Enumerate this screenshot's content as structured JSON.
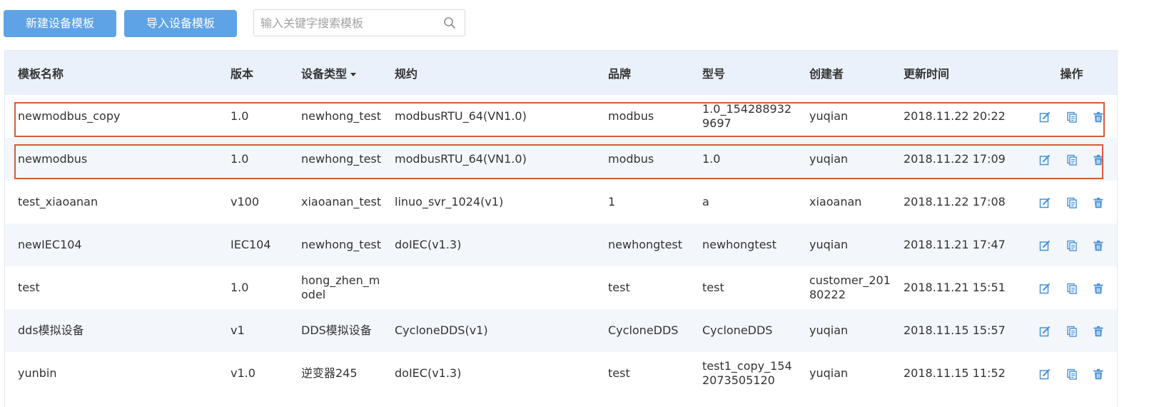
{
  "toolbar": {
    "new_button": "新建设备模板",
    "import_button": "导入设备模板",
    "search_placeholder": "输入关键字搜索模板",
    "search_value": ""
  },
  "colors": {
    "button_blue": "#5ea3e6",
    "header_bg": "#eaf1fa",
    "stripe_bg": "#f3f7fc",
    "icon_blue": "#4a90d9",
    "highlight_red": "#d95a3a"
  },
  "table": {
    "columns": [
      "模板名称",
      "版本",
      "设备类型",
      "规约",
      "品牌",
      "型号",
      "创建者",
      "更新时间",
      "操作"
    ],
    "sort_column": "设备类型",
    "rows": [
      {
        "name": "newmodbus_copy",
        "version": "1.0",
        "type": "newhong_test",
        "protocol": "modbusRTU_64(VN1.0)",
        "brand": "modbus",
        "model": "1.0_1542889329697",
        "creator": "yuqian",
        "updated": "2018.11.22 20:22"
      },
      {
        "name": "newmodbus",
        "version": "1.0",
        "type": "newhong_test",
        "protocol": "modbusRTU_64(VN1.0)",
        "brand": "modbus",
        "model": "1.0",
        "creator": "yuqian",
        "updated": "2018.11.22 17:09"
      },
      {
        "name": "test_xiaoanan",
        "version": "v100",
        "type": "xiaoanan_test",
        "protocol": "linuo_svr_1024(v1)",
        "brand": "1",
        "model": "a",
        "creator": "xiaoanan",
        "updated": "2018.11.22 17:08"
      },
      {
        "name": "newIEC104",
        "version": "IEC104",
        "type": "newhong_test",
        "protocol": "doIEC(v1.3)",
        "brand": "newhongtest",
        "model": "newhongtest",
        "creator": "yuqian",
        "updated": "2018.11.21 17:47"
      },
      {
        "name": "test",
        "version": "1.0",
        "type": "hong_zhen_model",
        "protocol": "",
        "brand": "test",
        "model": "test",
        "creator": "customer_20180222",
        "updated": "2018.11.21 15:51"
      },
      {
        "name": "dds模拟设备",
        "version": "v1",
        "type": "DDS模拟设备",
        "protocol": "CycloneDDS(v1)",
        "brand": "CycloneDDS",
        "model": "CycloneDDS",
        "creator": "yuqian",
        "updated": "2018.11.15 15:57"
      },
      {
        "name": "yunbin",
        "version": "v1.0",
        "type": "逆变器245",
        "protocol": "doIEC(v1.3)",
        "brand": "test",
        "model": "test1_copy_1542073505120",
        "creator": "yuqian",
        "updated": "2018.11.15 11:52"
      }
    ],
    "row_actions": [
      "edit-icon",
      "copy-icon",
      "delete-icon"
    ]
  }
}
